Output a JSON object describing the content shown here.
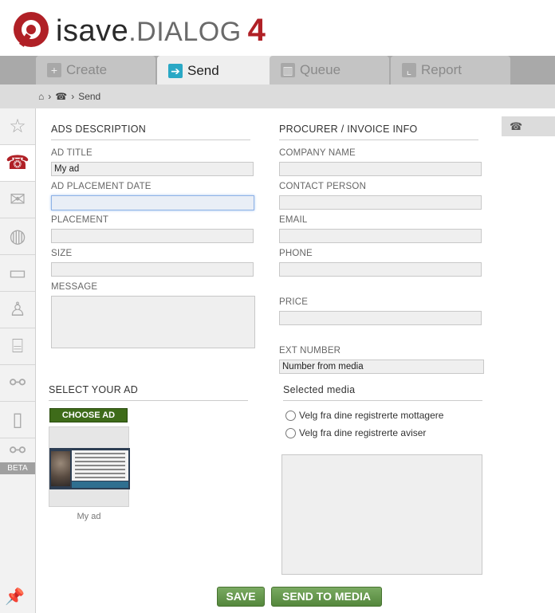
{
  "brand": {
    "name": "isave",
    "sub": ".DIALOG",
    "version": "4",
    "accent": "#b02026"
  },
  "tabs": [
    {
      "label": "Create",
      "icon": "plus-icon",
      "active": false
    },
    {
      "label": "Send",
      "icon": "arrow-right-icon",
      "active": true
    },
    {
      "label": "Queue",
      "icon": "queue-icon",
      "active": false
    },
    {
      "label": "Report",
      "icon": "report-icon",
      "active": false
    }
  ],
  "breadcrumb": {
    "current": "Send"
  },
  "sidebar": {
    "items": [
      "star-icon",
      "send-phone-icon",
      "mail-icon",
      "globe-icon",
      "folder-icon",
      "user-icon",
      "database-icon",
      "network-icon",
      "mobile-icon",
      "beta-network-icon"
    ],
    "beta_label": "BETA"
  },
  "ads": {
    "section_title": "ADS DESCRIPTION",
    "ad_title_label": "AD TITLE",
    "ad_title_value": "My ad",
    "placement_date_label": "AD PLACEMENT DATE",
    "placement_date_value": "",
    "placement_label": "PLACEMENT",
    "size_label": "SIZE",
    "message_label": "MESSAGE"
  },
  "procurer": {
    "section_title": "PROCURER / INVOICE INFO",
    "company_label": "COMPANY NAME",
    "contact_label": "CONTACT PERSON",
    "email_label": "EMAIL",
    "phone_label": "PHONE",
    "price_label": "PRICE",
    "ext_label": "EXT NUMBER",
    "ext_value": "Number from media"
  },
  "select_ad": {
    "section_title": "SELECT YOUR AD",
    "choose_label": "CHOOSE AD",
    "thumb_caption": "My ad"
  },
  "selected_media": {
    "section_title": "Selected media",
    "option1": "Velg fra dine registrerte mottagere",
    "option2": "Velg fra dine registrerte aviser"
  },
  "actions": {
    "save_label": "SAVE",
    "send_label": "SEND TO MEDIA"
  }
}
